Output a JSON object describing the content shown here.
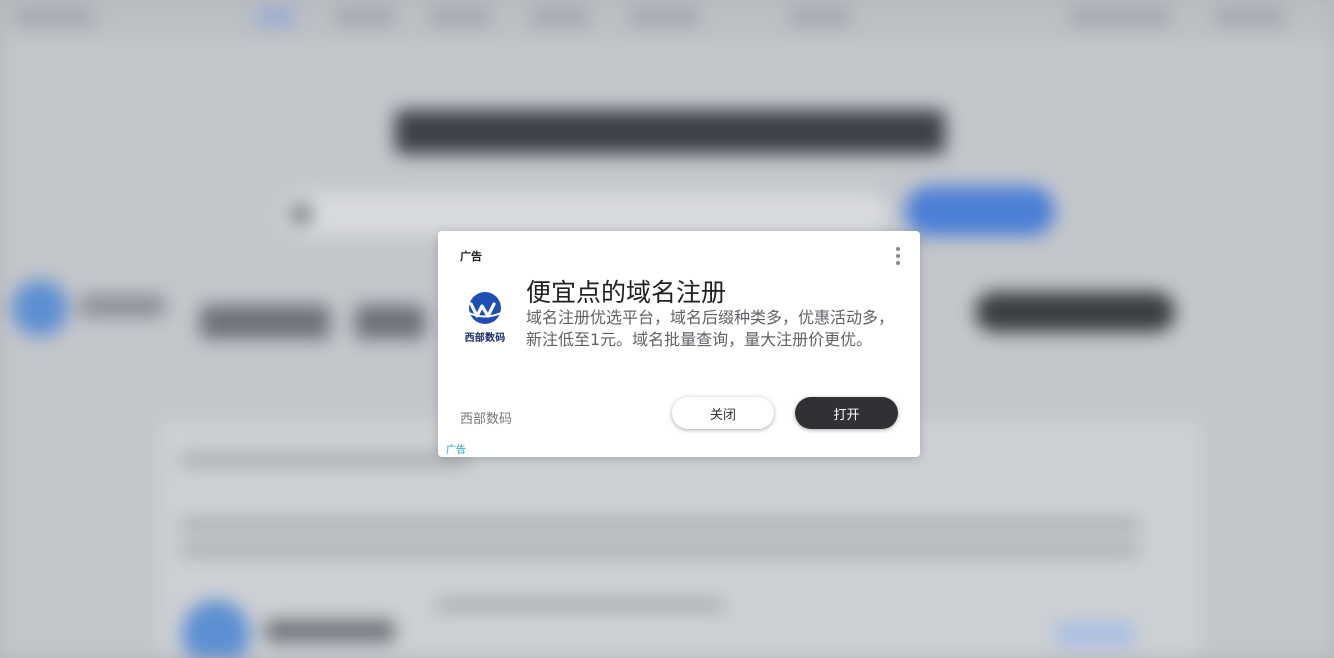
{
  "ad": {
    "top_label": "广告",
    "title": "便宜点的域名注册",
    "description": "域名注册优选平台，域名后缀种类多，优惠活动多，新注低至1元。域名批量查询，量大注册价更优。",
    "logo_text": "西部数码",
    "advertiser": "西部数码",
    "close_label": "关闭",
    "open_label": "打开",
    "bottom_label": "广告",
    "more_icon": "more-vertical-icon",
    "colors": {
      "open_button": "#303134",
      "logo_blue": "#1f4fb4",
      "ad_tag": "#1a9ec9"
    }
  }
}
